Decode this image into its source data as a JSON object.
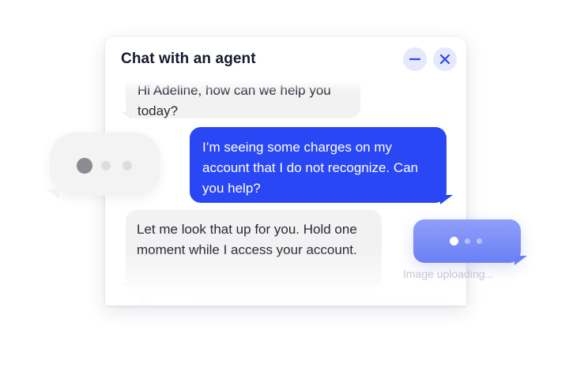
{
  "header": {
    "title": "Chat with an agent",
    "minimize_icon": "minus-icon",
    "close_icon": "close-icon"
  },
  "messages": [
    {
      "sender": "agent",
      "text": "Hi Adeline, how can we help you today?"
    },
    {
      "sender": "user",
      "text": "I’m seeing some charges on my account that I do not recognize. Can you help?"
    },
    {
      "sender": "agent",
      "text": "Let me look that up for you. Hold one moment while I access your account."
    }
  ],
  "upload": {
    "status": "Image uploading..."
  },
  "colors": {
    "accent": "#2a47f5",
    "agent_bubble": "#f2f2f3",
    "header_button_bg": "#e6e9fb",
    "title": "#151a2d"
  }
}
